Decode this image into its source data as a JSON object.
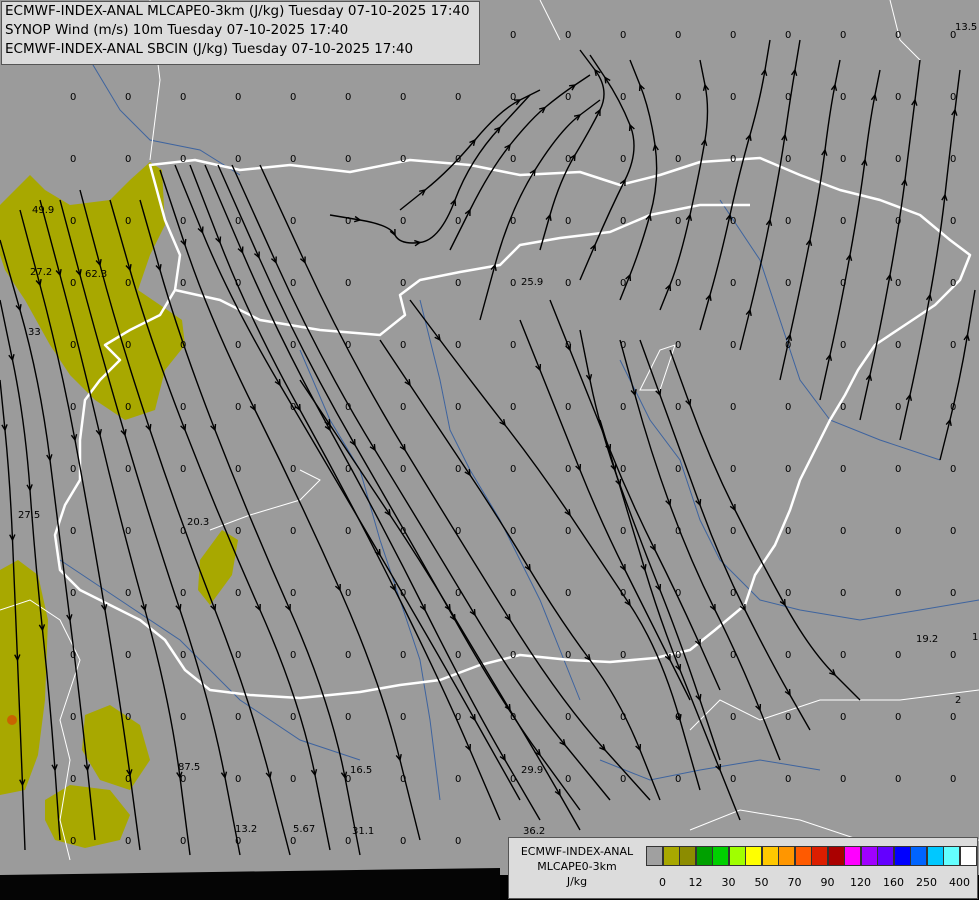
{
  "header": {
    "line1": "ECMWF-INDEX-ANAL MLCAPE0-3km (J/kg) Tuesday 07-10-2025 17:40",
    "line2": "SYNOP Wind (m/s) 10m Tuesday 07-10-2025 17:40",
    "line3": "ECMWF-INDEX-ANAL SBCIN (J/kg) Tuesday 07-10-2025 17:40"
  },
  "legend": {
    "title1": "ECMWF-INDEX-ANAL",
    "title2": "MLCAPE0-3km",
    "unit": "J/kg",
    "colors": [
      "#a0a0a0",
      "#a8a800",
      "#8c8c00",
      "#00a000",
      "#00d000",
      "#a0ff00",
      "#ffff00",
      "#ffc800",
      "#ff9600",
      "#ff5a00",
      "#dc1e00",
      "#aa0000",
      "#ff00ff",
      "#a000ff",
      "#6400ff",
      "#0000ff",
      "#0064ff",
      "#00c8ff",
      "#64ffff",
      "#ffffff"
    ],
    "ticks": [
      "0",
      "12",
      "30",
      "50",
      "70",
      "90",
      "120",
      "160",
      "250",
      "400"
    ]
  },
  "values": [
    {
      "t": "13.5"
    },
    {
      "t": "49.9"
    },
    {
      "t": "27.2"
    },
    {
      "t": "62.3"
    },
    {
      "t": "33"
    },
    {
      "t": "25.9"
    },
    {
      "t": "27.5"
    },
    {
      "t": "20.3"
    },
    {
      "t": "19.2"
    },
    {
      "t": "87.5"
    },
    {
      "t": "16.5"
    },
    {
      "t": "29.9"
    },
    {
      "t": "13.2"
    },
    {
      "t": "5.67"
    },
    {
      "t": "31.1"
    },
    {
      "t": "36.2"
    },
    {
      "t": "2"
    },
    {
      "t": "1"
    },
    {
      "t": "0"
    }
  ]
}
